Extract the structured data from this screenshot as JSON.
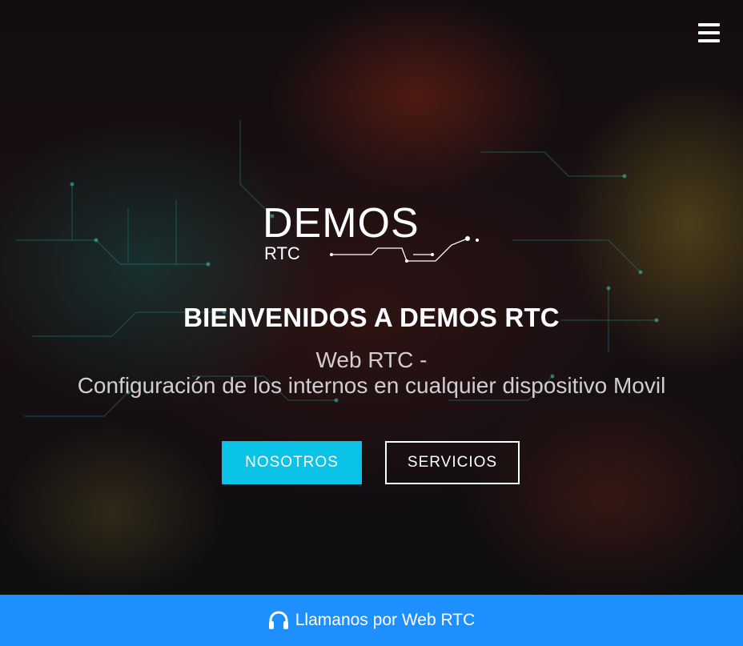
{
  "nav": {
    "menu_icon": "hamburger-menu-icon"
  },
  "logo": {
    "main_text": "DEMOS",
    "sub_text": "RTC"
  },
  "hero": {
    "title": "BIENVENIDOS A DEMOS RTC",
    "subtitle_line1": "Web RTC -",
    "subtitle_line2": "Configuración de los internos en cualquier dispositivo Movil",
    "primary_button": "NOSOTROS",
    "secondary_button": "SERVICIOS"
  },
  "footer": {
    "icon": "headphones-icon",
    "label": "Llamanos por Web RTC"
  },
  "colors": {
    "accent_cyan": "#0bc3e6",
    "footer_blue": "#1e8fff"
  }
}
